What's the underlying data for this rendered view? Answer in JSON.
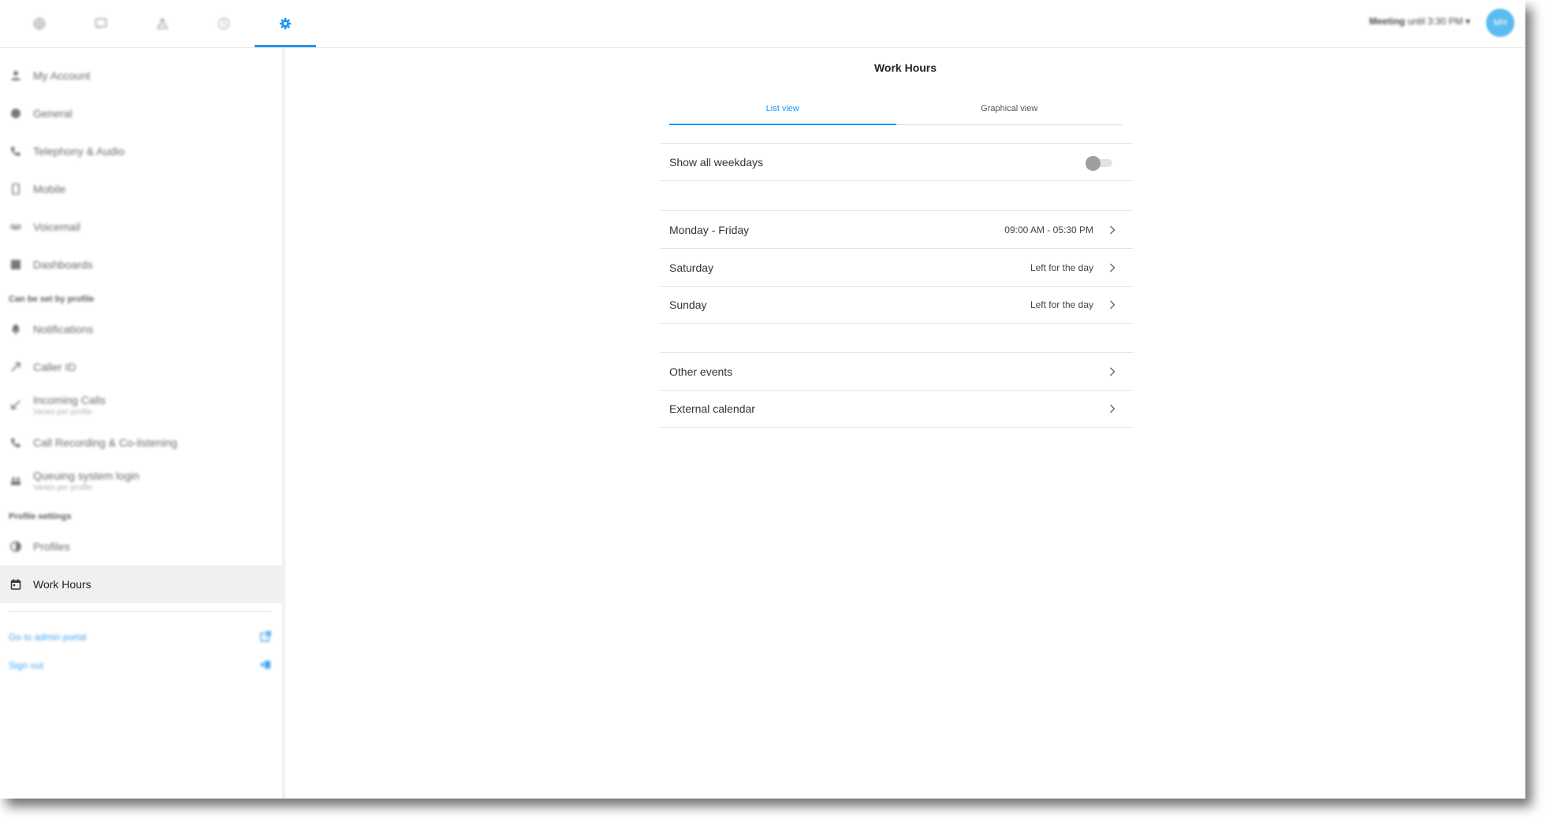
{
  "accent_color": "#2196f3",
  "topbar": {
    "tabs": [
      {
        "icon": "globe-icon",
        "active": false
      },
      {
        "icon": "chat-icon",
        "active": false
      },
      {
        "icon": "people-icon",
        "active": false
      },
      {
        "icon": "clock-icon",
        "active": false
      },
      {
        "icon": "gear-icon",
        "active": true
      }
    ],
    "status_label": "Meeting",
    "status_detail": "until 3:30 PM",
    "avatar_initials": "MH"
  },
  "sidebar": {
    "items": [
      {
        "label": "My Account",
        "icon": "person-icon"
      },
      {
        "label": "General",
        "icon": "globe-icon"
      },
      {
        "label": "Telephony & Audio",
        "icon": "phone-icon"
      },
      {
        "label": "Mobile",
        "icon": "mobile-icon"
      },
      {
        "label": "Voicemail",
        "icon": "voicemail-icon"
      },
      {
        "label": "Dashboards",
        "icon": "dashboard-icon"
      }
    ],
    "profile_section_heading": "Can be set by profile",
    "profile_items": [
      {
        "label": "Notifications",
        "sub": "",
        "icon": "bell-icon"
      },
      {
        "label": "Caller ID",
        "sub": "",
        "icon": "outgoing-call-icon"
      },
      {
        "label": "Incoming Calls",
        "sub": "Varies per profile",
        "icon": "incoming-call-icon"
      },
      {
        "label": "Call Recording & Co-listening",
        "sub": "",
        "icon": "call-recording-icon"
      },
      {
        "label": "Queuing system login",
        "sub": "Varies per profile",
        "icon": "queue-icon"
      }
    ],
    "profile_settings_heading": "Profile settings",
    "profiles_label": "Profiles",
    "active_item": {
      "label": "Work Hours",
      "icon": "calendar-icon"
    },
    "admin_portal_link": "Go to admin portal",
    "sign_out_link": "Sign out"
  },
  "main": {
    "title": "Work Hours",
    "tabs": [
      {
        "label": "List view",
        "active": true
      },
      {
        "label": "Graphical view",
        "active": false
      }
    ],
    "show_all_weekdays": {
      "label": "Show all weekdays",
      "enabled": false
    },
    "schedule": [
      {
        "label": "Monday - Friday",
        "value": "09:00 AM - 05:30 PM"
      },
      {
        "label": "Saturday",
        "value": "Left for the day"
      },
      {
        "label": "Sunday",
        "value": "Left for the day"
      }
    ],
    "extras": [
      {
        "label": "Other events"
      },
      {
        "label": "External calendar"
      }
    ]
  }
}
